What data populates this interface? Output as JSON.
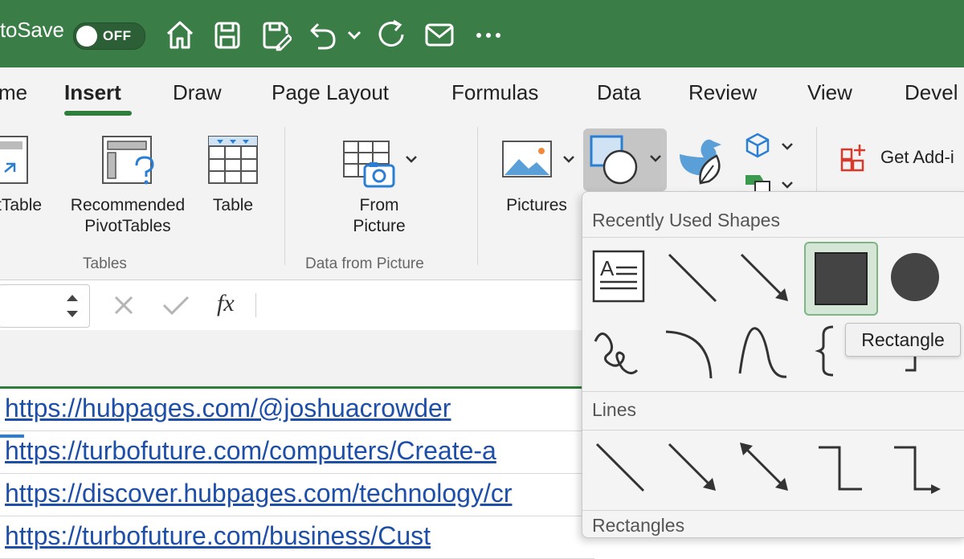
{
  "titlebar": {
    "autosave_label": "toSave",
    "toggle_state": "OFF",
    "bg_color": "#3b7d46"
  },
  "tabs": [
    {
      "label": "me"
    },
    {
      "label": "Insert",
      "active": true
    },
    {
      "label": "Draw"
    },
    {
      "label": "Page Layout"
    },
    {
      "label": "Formulas"
    },
    {
      "label": "Data"
    },
    {
      "label": "Review"
    },
    {
      "label": "View"
    },
    {
      "label": "Devel"
    }
  ],
  "ribbon": {
    "pivottable": "tTable",
    "recommended_line1": "Recommended",
    "recommended_line2": "PivotTables",
    "table": "Table",
    "group_tables": "Tables",
    "from_picture_line1": "From",
    "from_picture_line2": "Picture",
    "group_data_from_picture": "Data from Picture",
    "pictures": "Pictures",
    "get_addins": "Get Add-i"
  },
  "formulabar": {
    "fx": "fx"
  },
  "cells": [
    "https://hubpages.com/@joshuacrowder",
    "https://turbofuture.com/computers/Create-a",
    "https://discover.hubpages.com/technology/cr",
    "https://turbofuture.com/business/Cust"
  ],
  "shapes_panel": {
    "recent_title": "Recently Used Shapes",
    "lines_title": "Lines",
    "rectangles_title": "Rectangles",
    "tooltip": "Rectangle"
  }
}
